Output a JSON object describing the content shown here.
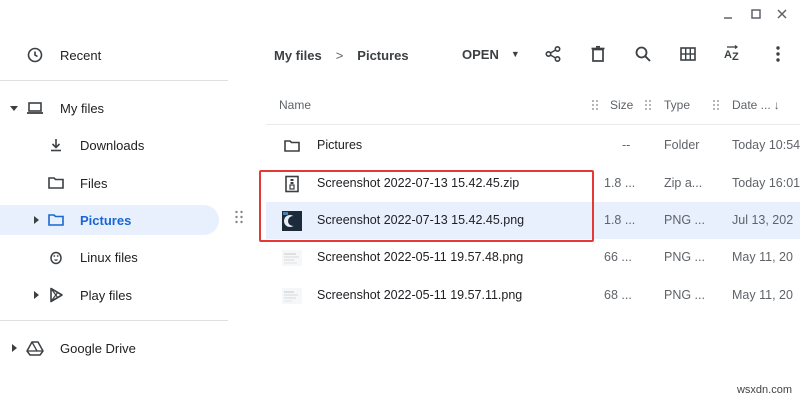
{
  "window": {
    "minimize_icon": "minimize-icon",
    "maximize_icon": "maximize-icon",
    "close_icon": "close-icon"
  },
  "sidebar": {
    "items": [
      {
        "label": "Recent",
        "icon": "clock-icon"
      },
      {
        "label": "My files",
        "icon": "laptop-icon"
      },
      {
        "label": "Downloads",
        "icon": "download-icon"
      },
      {
        "label": "Files",
        "icon": "folder-icon"
      },
      {
        "label": "Pictures",
        "icon": "folder-icon",
        "selected": true
      },
      {
        "label": "Linux files",
        "icon": "penguin-icon"
      },
      {
        "label": "Play files",
        "icon": "play-store-icon"
      },
      {
        "label": "Google Drive",
        "icon": "drive-icon"
      }
    ]
  },
  "breadcrumb": {
    "root": "My files",
    "separator": ">",
    "current": "Pictures"
  },
  "toolbar": {
    "open_label": "OPEN",
    "icons": [
      "share-icon",
      "delete-icon",
      "search-icon",
      "grid-view-icon",
      "sort-az-icon",
      "more-vert-icon"
    ]
  },
  "table": {
    "columns": {
      "name": "Name",
      "size": "Size",
      "type": "Type",
      "date": "Date ..."
    },
    "rows": [
      {
        "name": "Pictures",
        "size": "--",
        "type": "Folder",
        "date": "Today 10:54",
        "icon": "folder-icon"
      },
      {
        "name": "Screenshot 2022-07-13 15.42.45.zip",
        "size": "1.8 ...",
        "type": "Zip a...",
        "date": "Today 16:01",
        "icon": "zip-icon"
      },
      {
        "name": "Screenshot 2022-07-13 15.42.45.png",
        "size": "1.8 ...",
        "type": "PNG ...",
        "date": "Jul 13, 202",
        "icon": "image-thumbnail-icon",
        "selected": true
      },
      {
        "name": "Screenshot 2022-05-11 19.57.48.png",
        "size": "66 ...",
        "type": "PNG ...",
        "date": "May 11, 20",
        "icon": "image-thumbnail-icon"
      },
      {
        "name": "Screenshot 2022-05-11 19.57.11.png",
        "size": "68 ...",
        "type": "PNG ...",
        "date": "May 11, 20",
        "icon": "image-thumbnail-icon"
      }
    ]
  },
  "watermark": "wsxdn.com",
  "colors": {
    "selection": "#e8f0fe",
    "accent": "#1967d2",
    "highlight_border": "#e53935"
  }
}
